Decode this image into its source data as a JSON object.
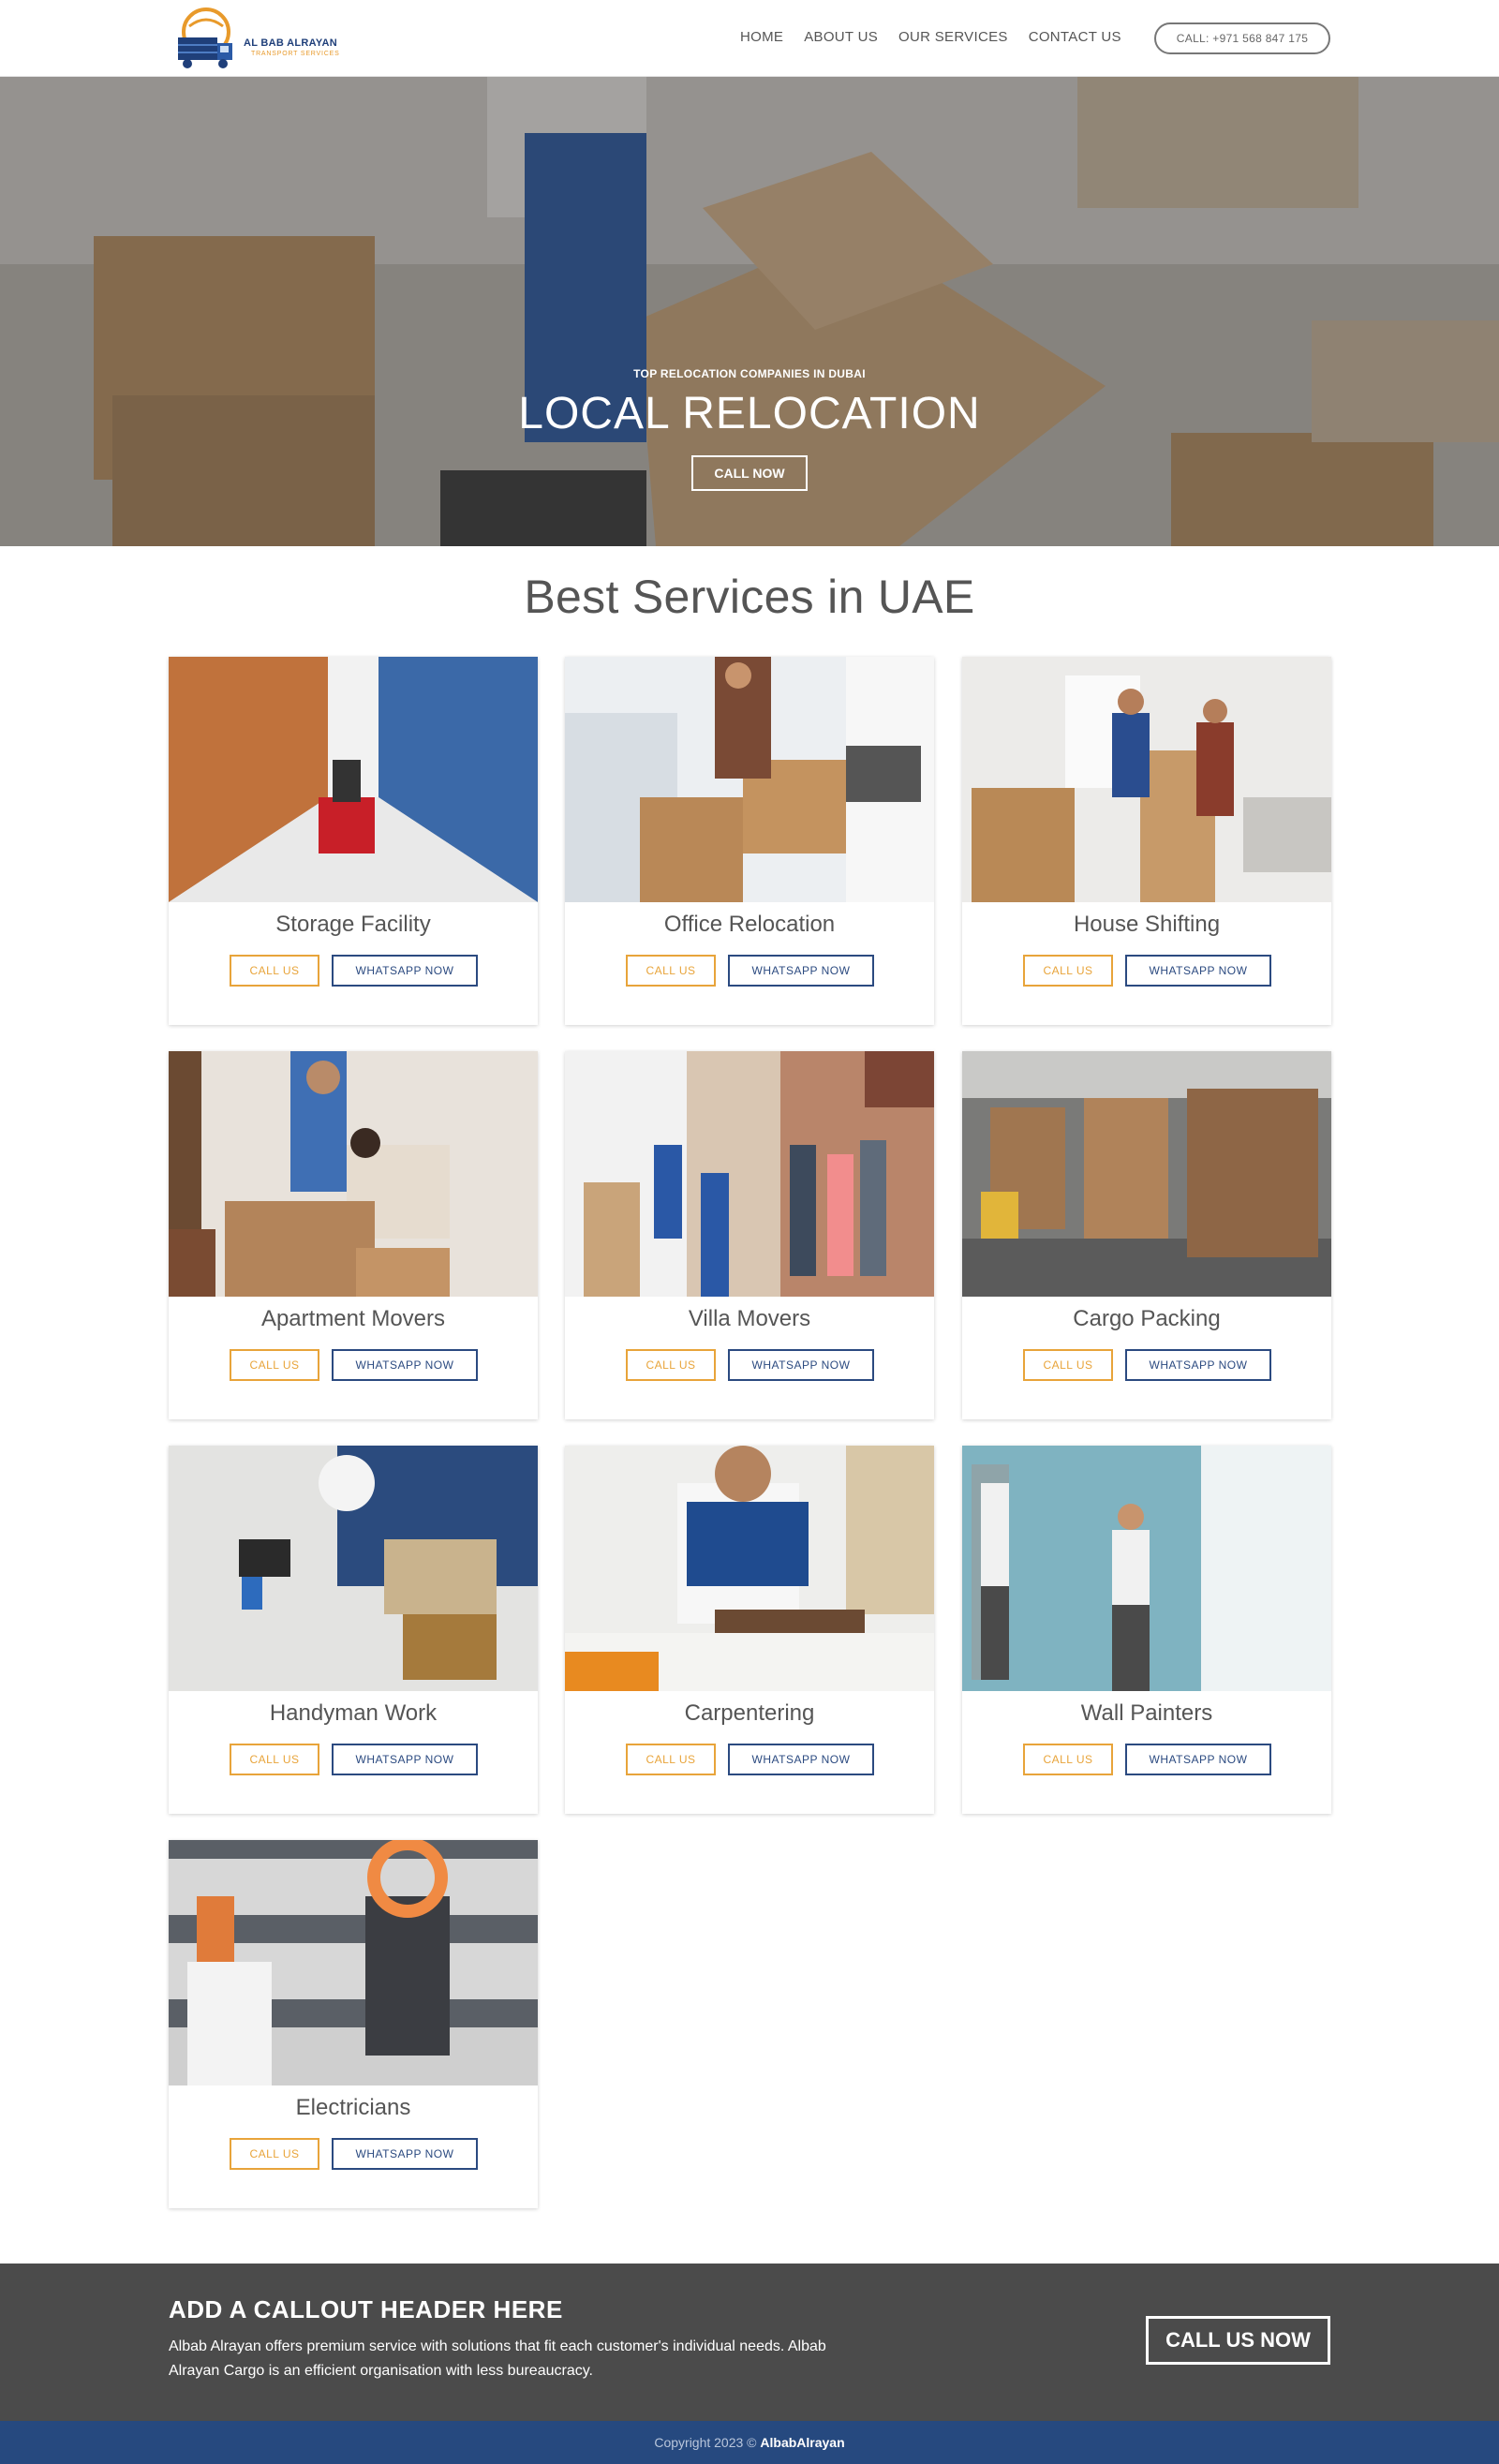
{
  "brand": {
    "name": "AL BAB ALRAYAN",
    "tagline": "TRANSPORT SERVICES",
    "colors": {
      "navy": "#1f3f7a",
      "orange": "#e89a2b"
    }
  },
  "nav": {
    "items": [
      "HOME",
      "ABOUT US",
      "OUR SERVICES",
      "CONTACT US"
    ],
    "call": "CALL: +971 568 847 175"
  },
  "hero": {
    "eyebrow": "TOP RELOCATION COMPANIES IN DUBAI",
    "title": "LOCAL RELOCATION",
    "button": "CALL NOW"
  },
  "services": {
    "title": "Best Services in UAE",
    "call_label": "CALL US",
    "whatsapp_label": "WHATSAPP NOW",
    "items": [
      {
        "name": "Storage Facility",
        "image": "warehouse-shelves-forklift"
      },
      {
        "name": "Office Relocation",
        "image": "office-boxes-woman"
      },
      {
        "name": "House Shifting",
        "image": "two-men-boxes-dolly"
      },
      {
        "name": "Apartment Movers",
        "image": "couple-packing-boxes"
      },
      {
        "name": "Villa Movers",
        "image": "movers-unloading-truck"
      },
      {
        "name": "Cargo Packing",
        "image": "warehouse-pallets"
      },
      {
        "name": "Handyman Work",
        "image": "worker-drilling-wall"
      },
      {
        "name": "Carpentering",
        "image": "carpenter-workbench"
      },
      {
        "name": "Wall Painters",
        "image": "painters-rolling-wall"
      },
      {
        "name": "Electricians",
        "image": "multimeter-switchboard"
      }
    ]
  },
  "callout": {
    "title": "ADD A CALLOUT HEADER HERE",
    "text": "Albab Alrayan offers premium service with solutions that fit each customer's individual needs. Albab Alrayan Cargo is an efficient organisation with less bureaucracy.",
    "button": "CALL US NOW"
  },
  "footer": {
    "prefix": "Copyright 2023 © ",
    "brand": "AlbabAlrayan"
  }
}
